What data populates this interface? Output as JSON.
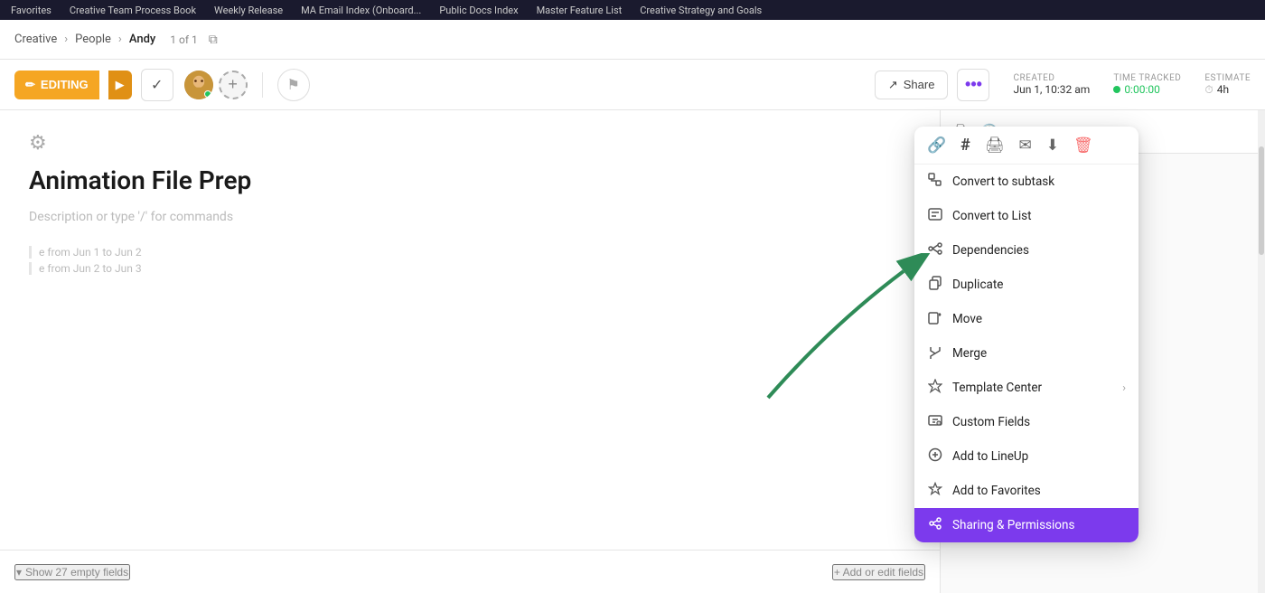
{
  "topNav": {
    "items": [
      {
        "label": "Favorites",
        "active": false
      },
      {
        "label": "Creative Team Process Book",
        "active": false
      },
      {
        "label": "Weekly Release",
        "active": false
      },
      {
        "label": "MA Email Index (Onboard...",
        "active": false
      },
      {
        "label": "Public Docs Index",
        "active": false
      },
      {
        "label": "Master Feature List",
        "active": false
      },
      {
        "label": "Creative Strategy and Goals",
        "active": false
      }
    ]
  },
  "breadcrumb": {
    "parts": [
      "Creative",
      "People",
      "Andy"
    ],
    "count": "1 of 1"
  },
  "toolbar": {
    "editing_label": "EDITING",
    "check_icon": "✓",
    "share_label": "Share",
    "more_dots": "•••",
    "created_label": "CREATED",
    "created_value": "Jun 1, 10:32 am",
    "time_tracked_label": "TIME TRACKED",
    "time_tracked_value": "0:00:00",
    "estimate_label": "ESTIMATE",
    "estimate_value": "4h"
  },
  "task": {
    "title": "Animation File Prep",
    "description": "Description or type '/' for commands",
    "footnote1": "e from Jun 1 to Jun 2",
    "footnote2": "e from Jun 2 to Jun 3"
  },
  "bottomBar": {
    "show_fields_label": "Show 27 empty fields",
    "add_fields_label": "+ Add or edit fields"
  },
  "contextMenu": {
    "icons": [
      {
        "name": "link-icon",
        "symbol": "🔗"
      },
      {
        "name": "hash-icon",
        "symbol": "#"
      },
      {
        "name": "print-icon",
        "symbol": "🖨"
      },
      {
        "name": "mail-icon",
        "symbol": "✉"
      },
      {
        "name": "download-icon",
        "symbol": "⬇"
      },
      {
        "name": "trash-icon",
        "symbol": "🗑"
      }
    ],
    "items": [
      {
        "id": "convert-subtask",
        "label": "Convert to subtask",
        "icon": "⤴",
        "arrow": false
      },
      {
        "id": "convert-list",
        "label": "Convert to List",
        "icon": "☰",
        "arrow": false
      },
      {
        "id": "dependencies",
        "label": "Dependencies",
        "icon": "🔗",
        "arrow": false
      },
      {
        "id": "duplicate",
        "label": "Duplicate",
        "icon": "⧉",
        "arrow": false
      },
      {
        "id": "move",
        "label": "Move",
        "icon": "📋",
        "arrow": false
      },
      {
        "id": "merge",
        "label": "Merge",
        "icon": "⎇",
        "arrow": false
      },
      {
        "id": "template-center",
        "label": "Template Center",
        "icon": "✦",
        "arrow": true
      },
      {
        "id": "custom-fields",
        "label": "Custom Fields",
        "icon": "✏",
        "arrow": false
      },
      {
        "id": "add-lineup",
        "label": "Add to LineUp",
        "icon": "⊕",
        "arrow": false
      },
      {
        "id": "add-favorites",
        "label": "Add to Favorites",
        "icon": "☆",
        "arrow": false
      },
      {
        "id": "sharing",
        "label": "Sharing & Permissions",
        "icon": "⟲",
        "arrow": false,
        "highlight": true
      }
    ]
  },
  "colors": {
    "accent_purple": "#7c3aed",
    "accent_orange": "#f5a623",
    "green": "#22c55e",
    "sharing_bg": "#7c3aed"
  }
}
